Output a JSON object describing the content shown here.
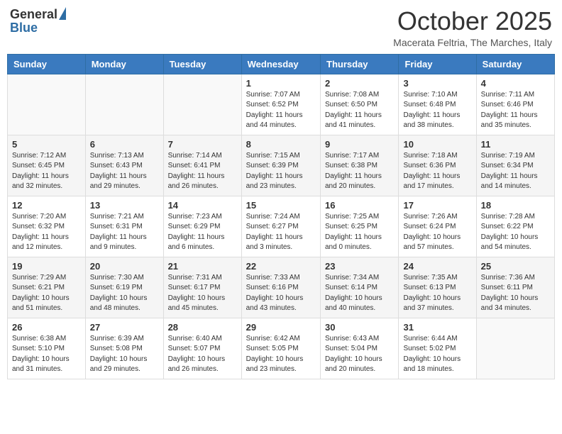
{
  "header": {
    "logo_general": "General",
    "logo_blue": "Blue",
    "month_year": "October 2025",
    "location": "Macerata Feltria, The Marches, Italy"
  },
  "days_of_week": [
    "Sunday",
    "Monday",
    "Tuesday",
    "Wednesday",
    "Thursday",
    "Friday",
    "Saturday"
  ],
  "weeks": [
    [
      {
        "day": "",
        "info": ""
      },
      {
        "day": "",
        "info": ""
      },
      {
        "day": "",
        "info": ""
      },
      {
        "day": "1",
        "info": "Sunrise: 7:07 AM\nSunset: 6:52 PM\nDaylight: 11 hours and 44 minutes."
      },
      {
        "day": "2",
        "info": "Sunrise: 7:08 AM\nSunset: 6:50 PM\nDaylight: 11 hours and 41 minutes."
      },
      {
        "day": "3",
        "info": "Sunrise: 7:10 AM\nSunset: 6:48 PM\nDaylight: 11 hours and 38 minutes."
      },
      {
        "day": "4",
        "info": "Sunrise: 7:11 AM\nSunset: 6:46 PM\nDaylight: 11 hours and 35 minutes."
      }
    ],
    [
      {
        "day": "5",
        "info": "Sunrise: 7:12 AM\nSunset: 6:45 PM\nDaylight: 11 hours and 32 minutes."
      },
      {
        "day": "6",
        "info": "Sunrise: 7:13 AM\nSunset: 6:43 PM\nDaylight: 11 hours and 29 minutes."
      },
      {
        "day": "7",
        "info": "Sunrise: 7:14 AM\nSunset: 6:41 PM\nDaylight: 11 hours and 26 minutes."
      },
      {
        "day": "8",
        "info": "Sunrise: 7:15 AM\nSunset: 6:39 PM\nDaylight: 11 hours and 23 minutes."
      },
      {
        "day": "9",
        "info": "Sunrise: 7:17 AM\nSunset: 6:38 PM\nDaylight: 11 hours and 20 minutes."
      },
      {
        "day": "10",
        "info": "Sunrise: 7:18 AM\nSunset: 6:36 PM\nDaylight: 11 hours and 17 minutes."
      },
      {
        "day": "11",
        "info": "Sunrise: 7:19 AM\nSunset: 6:34 PM\nDaylight: 11 hours and 14 minutes."
      }
    ],
    [
      {
        "day": "12",
        "info": "Sunrise: 7:20 AM\nSunset: 6:32 PM\nDaylight: 11 hours and 12 minutes."
      },
      {
        "day": "13",
        "info": "Sunrise: 7:21 AM\nSunset: 6:31 PM\nDaylight: 11 hours and 9 minutes."
      },
      {
        "day": "14",
        "info": "Sunrise: 7:23 AM\nSunset: 6:29 PM\nDaylight: 11 hours and 6 minutes."
      },
      {
        "day": "15",
        "info": "Sunrise: 7:24 AM\nSunset: 6:27 PM\nDaylight: 11 hours and 3 minutes."
      },
      {
        "day": "16",
        "info": "Sunrise: 7:25 AM\nSunset: 6:25 PM\nDaylight: 11 hours and 0 minutes."
      },
      {
        "day": "17",
        "info": "Sunrise: 7:26 AM\nSunset: 6:24 PM\nDaylight: 10 hours and 57 minutes."
      },
      {
        "day": "18",
        "info": "Sunrise: 7:28 AM\nSunset: 6:22 PM\nDaylight: 10 hours and 54 minutes."
      }
    ],
    [
      {
        "day": "19",
        "info": "Sunrise: 7:29 AM\nSunset: 6:21 PM\nDaylight: 10 hours and 51 minutes."
      },
      {
        "day": "20",
        "info": "Sunrise: 7:30 AM\nSunset: 6:19 PM\nDaylight: 10 hours and 48 minutes."
      },
      {
        "day": "21",
        "info": "Sunrise: 7:31 AM\nSunset: 6:17 PM\nDaylight: 10 hours and 45 minutes."
      },
      {
        "day": "22",
        "info": "Sunrise: 7:33 AM\nSunset: 6:16 PM\nDaylight: 10 hours and 43 minutes."
      },
      {
        "day": "23",
        "info": "Sunrise: 7:34 AM\nSunset: 6:14 PM\nDaylight: 10 hours and 40 minutes."
      },
      {
        "day": "24",
        "info": "Sunrise: 7:35 AM\nSunset: 6:13 PM\nDaylight: 10 hours and 37 minutes."
      },
      {
        "day": "25",
        "info": "Sunrise: 7:36 AM\nSunset: 6:11 PM\nDaylight: 10 hours and 34 minutes."
      }
    ],
    [
      {
        "day": "26",
        "info": "Sunrise: 6:38 AM\nSunset: 5:10 PM\nDaylight: 10 hours and 31 minutes."
      },
      {
        "day": "27",
        "info": "Sunrise: 6:39 AM\nSunset: 5:08 PM\nDaylight: 10 hours and 29 minutes."
      },
      {
        "day": "28",
        "info": "Sunrise: 6:40 AM\nSunset: 5:07 PM\nDaylight: 10 hours and 26 minutes."
      },
      {
        "day": "29",
        "info": "Sunrise: 6:42 AM\nSunset: 5:05 PM\nDaylight: 10 hours and 23 minutes."
      },
      {
        "day": "30",
        "info": "Sunrise: 6:43 AM\nSunset: 5:04 PM\nDaylight: 10 hours and 20 minutes."
      },
      {
        "day": "31",
        "info": "Sunrise: 6:44 AM\nSunset: 5:02 PM\nDaylight: 10 hours and 18 minutes."
      },
      {
        "day": "",
        "info": ""
      }
    ]
  ]
}
